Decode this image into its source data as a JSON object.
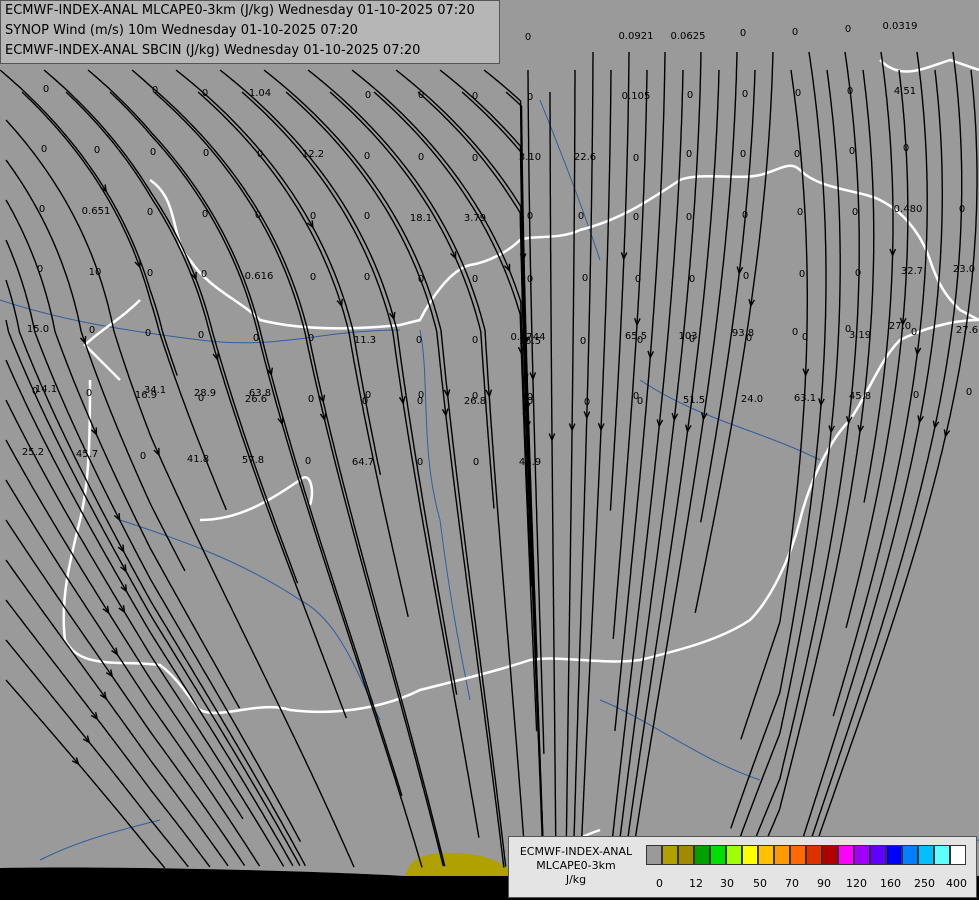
{
  "header": {
    "line1": "ECMWF-INDEX-ANAL MLCAPE0-3km (J/kg) Wednesday 01-10-2025 07:20",
    "line2": "SYNOP Wind (m/s) 10m Wednesday 01-10-2025 07:20",
    "line3": "ECMWF-INDEX-ANAL SBCIN (J/kg) Wednesday 01-10-2025 07:20"
  },
  "legend": {
    "title_line1": "ECMWF-INDEX-ANAL",
    "title_line2": "MLCAPE0-3km",
    "unit": "J/kg",
    "swatch_colors": [
      "#9a9a9a",
      "#b0a000",
      "#a08a00",
      "#00a000",
      "#00e000",
      "#a0ff00",
      "#ffff00",
      "#ffc000",
      "#ff9900",
      "#ff6a00",
      "#e03000",
      "#b00000",
      "#ff00ff",
      "#a000ff",
      "#6000ff",
      "#0000ff",
      "#0080ff",
      "#00c0ff",
      "#60ffff",
      "#ffffff"
    ],
    "ticks": [
      "0",
      "12",
      "30",
      "50",
      "70",
      "90",
      "120",
      "160",
      "250",
      "400"
    ]
  },
  "colors": {
    "background": "#9a9a9a",
    "borders": "#ffffff",
    "rivers": "#2f5f9f",
    "streamlines": "#000000",
    "cape_patch": "#b0a000"
  },
  "map_labels": [
    "0",
    "0.0921",
    "0.0625",
    "0",
    "0",
    "0",
    "0.0319",
    "0",
    "0",
    "0",
    "1.04",
    "0",
    "0",
    "0",
    "0",
    "0.105",
    "0",
    "0",
    "0",
    "0",
    "4.51",
    "0",
    "0",
    "0",
    "0",
    "0",
    "12.2",
    "0",
    "0",
    "0",
    "3.10",
    "22.6",
    "0",
    "0",
    "0",
    "0",
    "0",
    "0",
    "0",
    "0.651",
    "0",
    "0",
    "0",
    "0",
    "0",
    "18.1",
    "3.79",
    "0",
    "0",
    "0",
    "0",
    "0",
    "0",
    "0",
    "0.480",
    "0",
    "0",
    "10",
    "0",
    "0",
    "0.616",
    "0",
    "0",
    "0",
    "0",
    "0",
    "0",
    "0",
    "0",
    "0",
    "0",
    "0",
    "32.7",
    "23.0",
    "15.0",
    "0",
    "0",
    "0",
    "0",
    "0",
    "11.3",
    "0",
    "0",
    "15.5",
    "0",
    "0",
    "0",
    "0",
    "0",
    "3.19",
    "0",
    "27.6",
    "0",
    "0",
    "16.9",
    "0",
    "26.6",
    "0",
    "0",
    "0",
    "26.8",
    "0",
    "0",
    "0",
    "51.5",
    "24.0",
    "63.1",
    "45.8",
    "0",
    "0",
    "25.2",
    "45.7",
    "0",
    "41.8",
    "57.8",
    "0",
    "64.7",
    "0",
    "0",
    "44.9",
    "0.0744",
    "65.5",
    "103",
    "93.8",
    "0",
    "0",
    "27.0",
    "14.1",
    "34.1",
    "28.9",
    "63.8",
    "0",
    "0",
    "0",
    "0",
    "0"
  ]
}
